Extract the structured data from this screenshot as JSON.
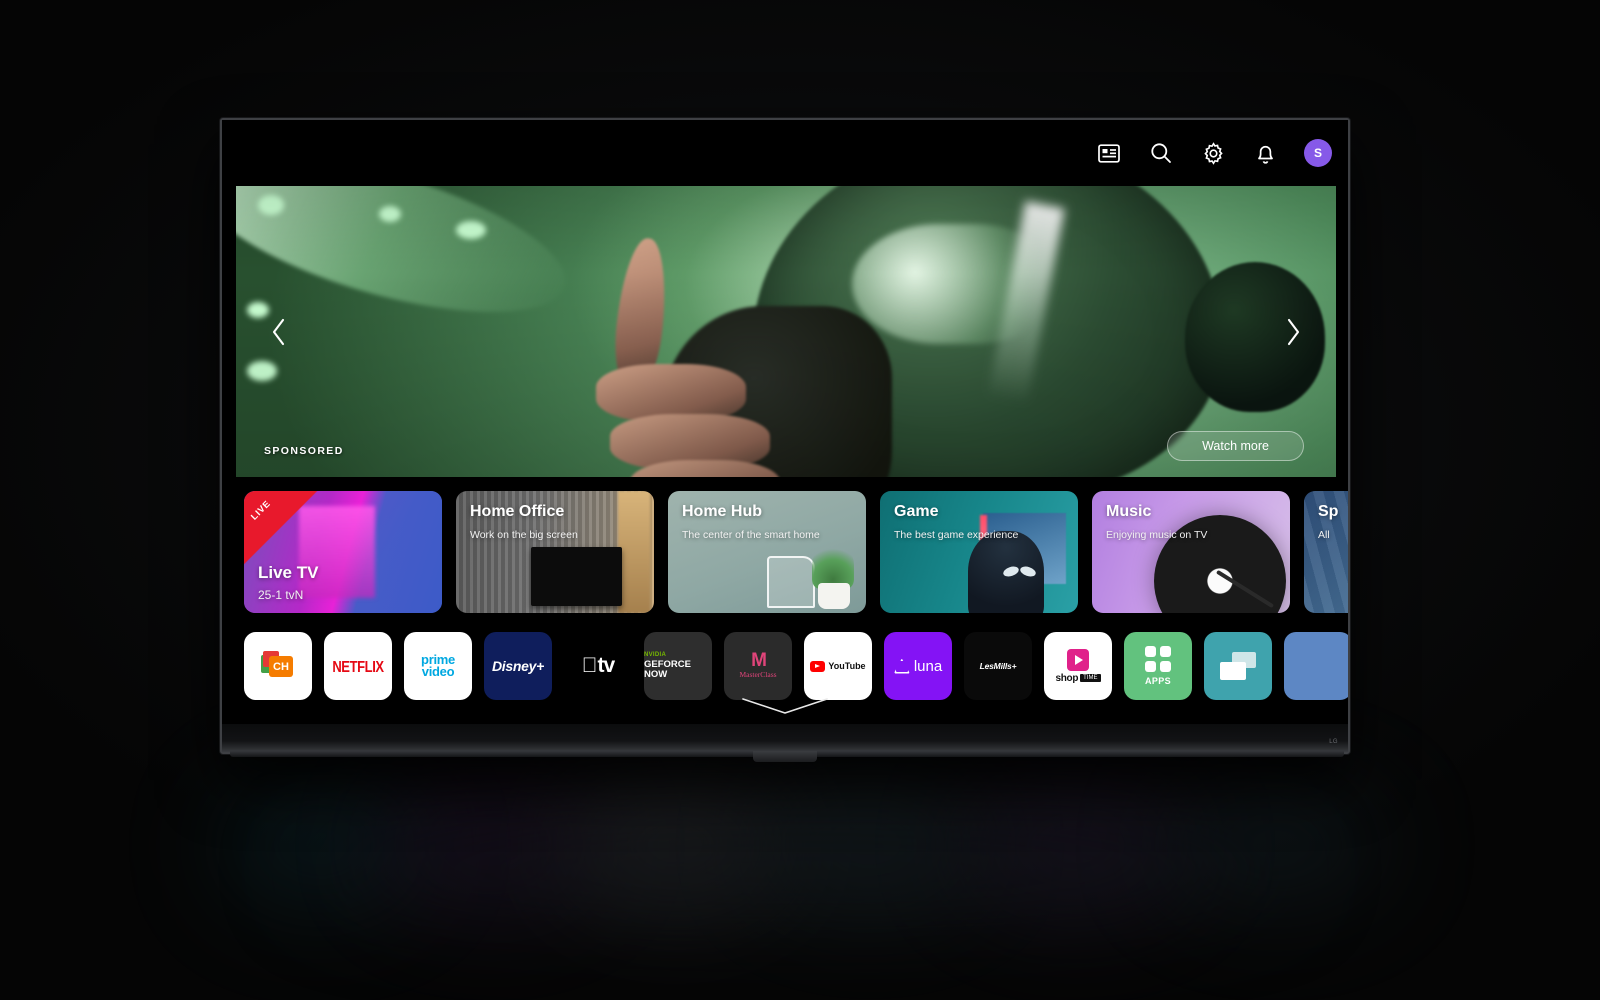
{
  "topbar": {
    "icons": [
      {
        "name": "guide-icon",
        "label": "TV Guide"
      },
      {
        "name": "search-icon",
        "label": "Search"
      },
      {
        "name": "gear-icon",
        "label": "Settings"
      },
      {
        "name": "bell-icon",
        "label": "Notifications"
      }
    ],
    "avatar_initial": "S",
    "avatar_color": "#8659e8"
  },
  "hero": {
    "sponsored_label": "SPONSORED",
    "watch_more_label": "Watch more",
    "prev_label": "‹",
    "next_label": "›"
  },
  "cards": [
    {
      "title": "Live TV",
      "subtitle": "25-1  tvN",
      "badge": "LIVE"
    },
    {
      "title": "Home Office",
      "subtitle": "Work on the big screen",
      "badge": ""
    },
    {
      "title": "Home Hub",
      "subtitle": "The center of the smart home",
      "badge": ""
    },
    {
      "title": "Game",
      "subtitle": "The best game experience",
      "badge": ""
    },
    {
      "title": "Music",
      "subtitle": "Enjoying music on TV",
      "badge": ""
    },
    {
      "title": "Sp",
      "subtitle": "All",
      "badge": ""
    }
  ],
  "apps": [
    {
      "name": "channels",
      "label": "CH"
    },
    {
      "name": "netflix",
      "label": "NETFLIX"
    },
    {
      "name": "prime-video",
      "label": "prime video"
    },
    {
      "name": "disney-plus",
      "label": "Disney+"
    },
    {
      "name": "apple-tv",
      "label": "tv"
    },
    {
      "name": "geforce-now",
      "label": "GEFORCE NOW",
      "brand": "NVIDIA"
    },
    {
      "name": "masterclass",
      "label": "MasterClass"
    },
    {
      "name": "youtube",
      "label": "YouTube"
    },
    {
      "name": "luna",
      "label": "luna"
    },
    {
      "name": "lesmills",
      "label": "LesMills+"
    },
    {
      "name": "shop-time",
      "label": "shop",
      "badge": "TIME"
    },
    {
      "name": "all-apps",
      "label": "APPS"
    },
    {
      "name": "screen-share",
      "label": ""
    },
    {
      "name": "blue-app",
      "label": ""
    }
  ],
  "footer": {
    "expand_label": "Show more",
    "brand_mark": "LG"
  }
}
